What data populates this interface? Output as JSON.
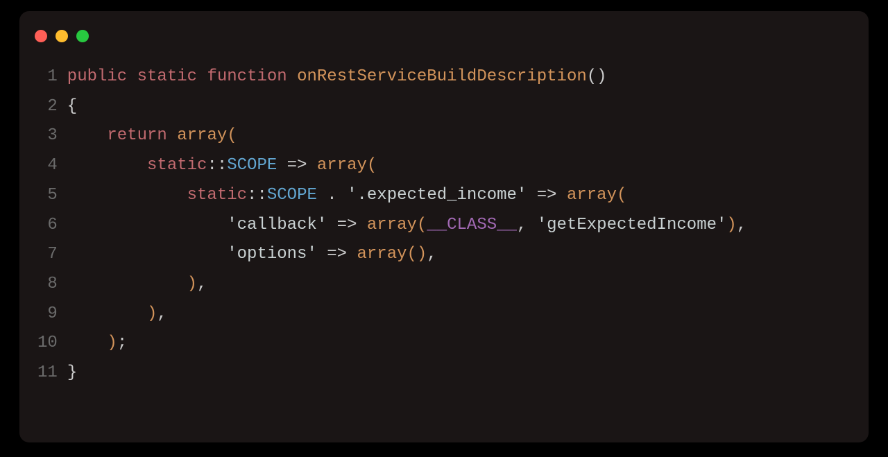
{
  "colors": {
    "background": "#1a1515",
    "window_radius_px": 14,
    "traffic_red": "#ff5f57",
    "traffic_yellow": "#febc2e",
    "traffic_green": "#28c840",
    "line_number": "#6b6b6b",
    "keyword": "#c16a6f",
    "function": "#d3945b",
    "constant": "#62a6d1",
    "string": "#c9d1d2",
    "magic": "#a36ab5",
    "punctuation": "#cccccc"
  },
  "lines": [
    {
      "n": "1",
      "tokens": [
        {
          "cls": "kw",
          "t": "public"
        },
        {
          "cls": "punc",
          "t": " "
        },
        {
          "cls": "kw",
          "t": "static"
        },
        {
          "cls": "punc",
          "t": " "
        },
        {
          "cls": "kw",
          "t": "function"
        },
        {
          "cls": "punc",
          "t": " "
        },
        {
          "cls": "fn",
          "t": "onRestServiceBuildDescription"
        },
        {
          "cls": "punc",
          "t": "()"
        }
      ]
    },
    {
      "n": "2",
      "tokens": [
        {
          "cls": "punc",
          "t": "{"
        }
      ]
    },
    {
      "n": "3",
      "tokens": [
        {
          "cls": "punc",
          "t": "    "
        },
        {
          "cls": "kw",
          "t": "return"
        },
        {
          "cls": "punc",
          "t": " "
        },
        {
          "cls": "fn",
          "t": "array"
        },
        {
          "cls": "brace",
          "t": "("
        }
      ]
    },
    {
      "n": "4",
      "tokens": [
        {
          "cls": "punc",
          "t": "        "
        },
        {
          "cls": "cls",
          "t": "static"
        },
        {
          "cls": "punc",
          "t": "::"
        },
        {
          "cls": "const",
          "t": "SCOPE"
        },
        {
          "cls": "punc",
          "t": " "
        },
        {
          "cls": "arrow",
          "t": "=>"
        },
        {
          "cls": "punc",
          "t": " "
        },
        {
          "cls": "fn",
          "t": "array"
        },
        {
          "cls": "brace",
          "t": "("
        }
      ]
    },
    {
      "n": "5",
      "tokens": [
        {
          "cls": "punc",
          "t": "            "
        },
        {
          "cls": "cls",
          "t": "static"
        },
        {
          "cls": "punc",
          "t": "::"
        },
        {
          "cls": "const",
          "t": "SCOPE"
        },
        {
          "cls": "punc",
          "t": " . "
        },
        {
          "cls": "str",
          "t": "'.expected_income'"
        },
        {
          "cls": "punc",
          "t": " "
        },
        {
          "cls": "arrow",
          "t": "=>"
        },
        {
          "cls": "punc",
          "t": " "
        },
        {
          "cls": "fn",
          "t": "array"
        },
        {
          "cls": "brace",
          "t": "("
        }
      ]
    },
    {
      "n": "6",
      "tokens": [
        {
          "cls": "punc",
          "t": "                "
        },
        {
          "cls": "str",
          "t": "'callback'"
        },
        {
          "cls": "punc",
          "t": " "
        },
        {
          "cls": "arrow",
          "t": "=>"
        },
        {
          "cls": "punc",
          "t": " "
        },
        {
          "cls": "fn",
          "t": "array"
        },
        {
          "cls": "brace",
          "t": "("
        },
        {
          "cls": "magic",
          "t": "__CLASS__"
        },
        {
          "cls": "punc",
          "t": ", "
        },
        {
          "cls": "str",
          "t": "'getExpectedIncome'"
        },
        {
          "cls": "brace",
          "t": ")"
        },
        {
          "cls": "punc",
          "t": ","
        }
      ]
    },
    {
      "n": "7",
      "tokens": [
        {
          "cls": "punc",
          "t": "                "
        },
        {
          "cls": "str",
          "t": "'options'"
        },
        {
          "cls": "punc",
          "t": " "
        },
        {
          "cls": "arrow",
          "t": "=>"
        },
        {
          "cls": "punc",
          "t": " "
        },
        {
          "cls": "fn",
          "t": "array"
        },
        {
          "cls": "brace",
          "t": "()"
        },
        {
          "cls": "punc",
          "t": ","
        }
      ]
    },
    {
      "n": "8",
      "tokens": [
        {
          "cls": "punc",
          "t": "            "
        },
        {
          "cls": "brace",
          "t": ")"
        },
        {
          "cls": "punc",
          "t": ","
        }
      ]
    },
    {
      "n": "9",
      "tokens": [
        {
          "cls": "punc",
          "t": "        "
        },
        {
          "cls": "brace",
          "t": ")"
        },
        {
          "cls": "punc",
          "t": ","
        }
      ]
    },
    {
      "n": "10",
      "tokens": [
        {
          "cls": "punc",
          "t": "    "
        },
        {
          "cls": "brace",
          "t": ")"
        },
        {
          "cls": "punc",
          "t": ";"
        }
      ]
    },
    {
      "n": "11",
      "tokens": [
        {
          "cls": "punc",
          "t": "}"
        }
      ]
    }
  ]
}
